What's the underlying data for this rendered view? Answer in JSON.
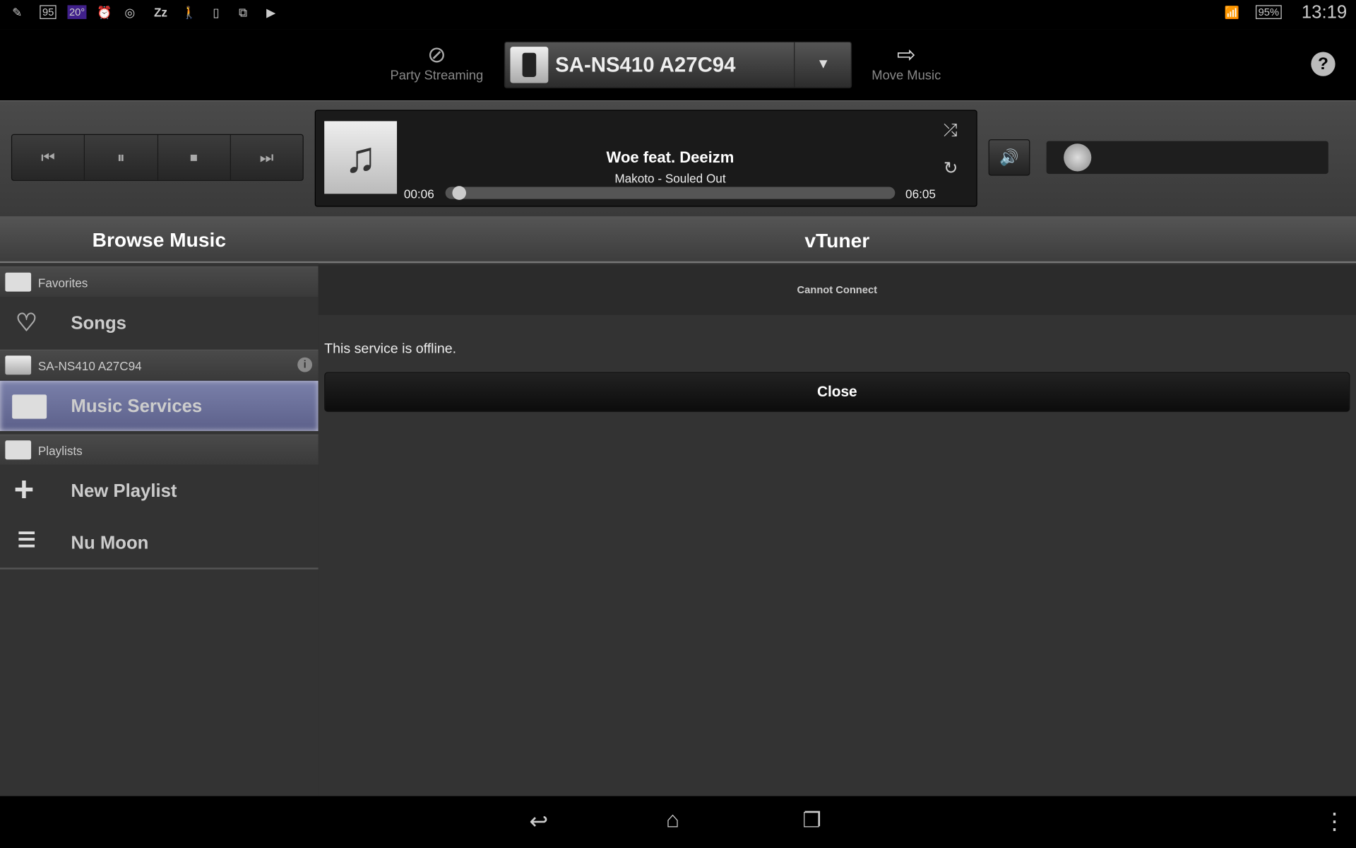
{
  "status_bar": {
    "badge_95": "95",
    "temperature": "20°",
    "battery": "95%",
    "time": "13:19"
  },
  "top_bar": {
    "party_streaming": "Party Streaming",
    "device_name": "SA-NS410 A27C94",
    "move_music": "Move Music",
    "help": "?"
  },
  "player": {
    "title": "Woe feat. Deeizm",
    "subtitle": "Makoto - Souled Out",
    "elapsed": "00:06",
    "duration": "06:05",
    "progress_percent": 1.6,
    "volume_percent": 2
  },
  "browse": {
    "title": "Browse Music",
    "favorites_header": "Favorites",
    "songs": "Songs",
    "device_header": "SA-NS410 A27C94",
    "music_services": "Music Services",
    "playlists_header": "Playlists",
    "new_playlist": "New Playlist",
    "playlist_1": "Nu Moon"
  },
  "content": {
    "title": "vTuner",
    "dialog_title": "Cannot Connect",
    "message": "This service is offline.",
    "close": "Close"
  },
  "colors": {
    "selected_item": "#6a6f9a",
    "accent": "#ffffff"
  }
}
